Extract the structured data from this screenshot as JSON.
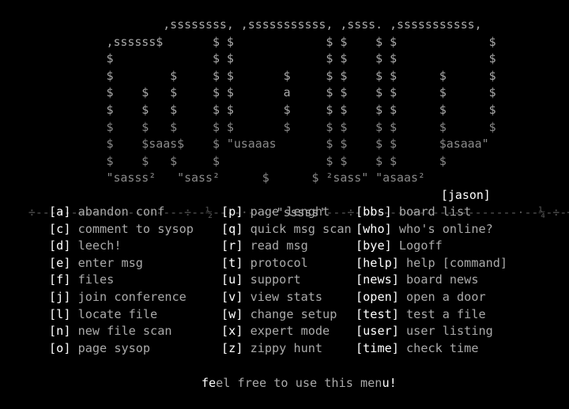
{
  "logo": {
    "lines": [
      "                       ,ssssssss, ,sssssssssss, ,ssss. ,sssssssssss,",
      "               ,ssssss$       $ $             $ $    $ $             $",
      "               $              $ $             $ $    $ $             $",
      "               $        $     $ $       $     $ $    $ $      $      $",
      "               $    $   $     $ $       a     $ $    $ $      $      $",
      "               $    $   $     $ $       $     $ $    $ $      $      $",
      "               $    $   $     $ $       $     $ $    $ $      $      $",
      "               $    $saas$    $ \"usaaas       $ $    $ $      $asaaa\"",
      "               $    $   $     $               $ $    $ $      $",
      "               \"sasss²   \"sass²      $      $ ²sass\" \"asaas²"
    ],
    "line8_suffix": "\"usaaas"
  },
  "user_tag": "[jason]",
  "divider": {
    "left": "÷---------------------÷--½----·---·",
    "word": "\"sssss'",
    "right": "---÷--------÷--------------·--¼-÷-÷"
  },
  "menu": {
    "columns": [
      [
        {
          "key": "a",
          "label": "abandon conf"
        },
        {
          "key": "c",
          "label": "comment to sysop"
        },
        {
          "key": "d",
          "label": "leech!"
        },
        {
          "key": "e",
          "label": "enter msg"
        },
        {
          "key": "f",
          "label": "files"
        },
        {
          "key": "j",
          "label": "join conference"
        },
        {
          "key": "l",
          "label": "locate file"
        },
        {
          "key": "n",
          "label": "new file scan"
        },
        {
          "key": "o",
          "label": "page sysop"
        }
      ],
      [
        {
          "key": "p",
          "label": "page lenght"
        },
        {
          "key": "q",
          "label": "quick msg scan"
        },
        {
          "key": "r",
          "label": "read msg"
        },
        {
          "key": "t",
          "label": "protocol"
        },
        {
          "key": "u",
          "label": "support"
        },
        {
          "key": "v",
          "label": "view stats"
        },
        {
          "key": "w",
          "label": "change setup"
        },
        {
          "key": "x",
          "label": "expert mode"
        },
        {
          "key": "z",
          "label": "zippy hunt"
        }
      ],
      [
        {
          "key": "bbs",
          "label": "board list"
        },
        {
          "key": "who",
          "label": "who's online?"
        },
        {
          "key": "bye",
          "label": "Logoff"
        },
        {
          "key": "help",
          "label": "help [command]"
        },
        {
          "key": "news",
          "label": "board news"
        },
        {
          "key": "open",
          "label": "open a door"
        },
        {
          "key": "test",
          "label": "test a file"
        },
        {
          "key": "user",
          "label": "user listing"
        },
        {
          "key": "time",
          "label": "check time"
        }
      ]
    ]
  },
  "footer": {
    "pre": "",
    "hi1": "fe",
    "mid": "el free to use this men",
    "hi2": "u!"
  },
  "colors": {
    "background": "#000000",
    "text": "#aaaaaa",
    "highlight": "#ffffff",
    "divider": "#555555"
  }
}
